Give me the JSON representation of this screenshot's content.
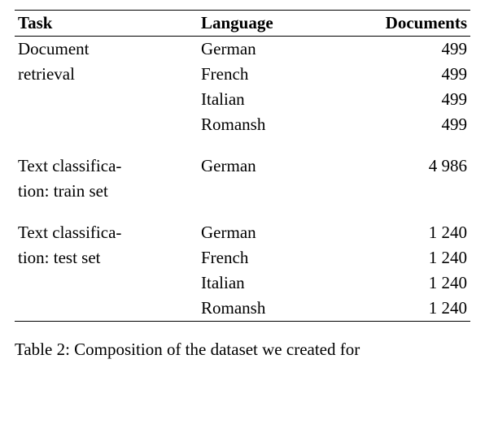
{
  "headers": {
    "task": "Task",
    "language": "Language",
    "documents": "Documents"
  },
  "groups": [
    {
      "task_lines": [
        "Document",
        "retrieval"
      ],
      "rows": [
        {
          "language": "German",
          "documents": "499"
        },
        {
          "language": "French",
          "documents": "499"
        },
        {
          "language": "Italian",
          "documents": "499"
        },
        {
          "language": "Romansh",
          "documents": "499"
        }
      ]
    },
    {
      "task_lines": [
        "Text classifica-",
        "tion: train set"
      ],
      "rows": [
        {
          "language": "German",
          "documents": "4 986"
        }
      ]
    },
    {
      "task_lines": [
        "Text classifica-",
        "tion: test set"
      ],
      "rows": [
        {
          "language": "German",
          "documents": "1 240"
        },
        {
          "language": "French",
          "documents": "1 240"
        },
        {
          "language": "Italian",
          "documents": "1 240"
        },
        {
          "language": "Romansh",
          "documents": "1 240"
        }
      ]
    }
  ],
  "caption_prefix": "Table 2: Composition of the dataset we created for",
  "chart_data": {
    "type": "table",
    "title": "Dataset composition by task and language",
    "columns": [
      "Task",
      "Language",
      "Documents"
    ],
    "rows": [
      [
        "Document retrieval",
        "German",
        499
      ],
      [
        "Document retrieval",
        "French",
        499
      ],
      [
        "Document retrieval",
        "Italian",
        499
      ],
      [
        "Document retrieval",
        "Romansh",
        499
      ],
      [
        "Text classification: train set",
        "German",
        4986
      ],
      [
        "Text classification: test set",
        "German",
        1240
      ],
      [
        "Text classification: test set",
        "French",
        1240
      ],
      [
        "Text classification: test set",
        "Italian",
        1240
      ],
      [
        "Text classification: test set",
        "Romansh",
        1240
      ]
    ]
  }
}
